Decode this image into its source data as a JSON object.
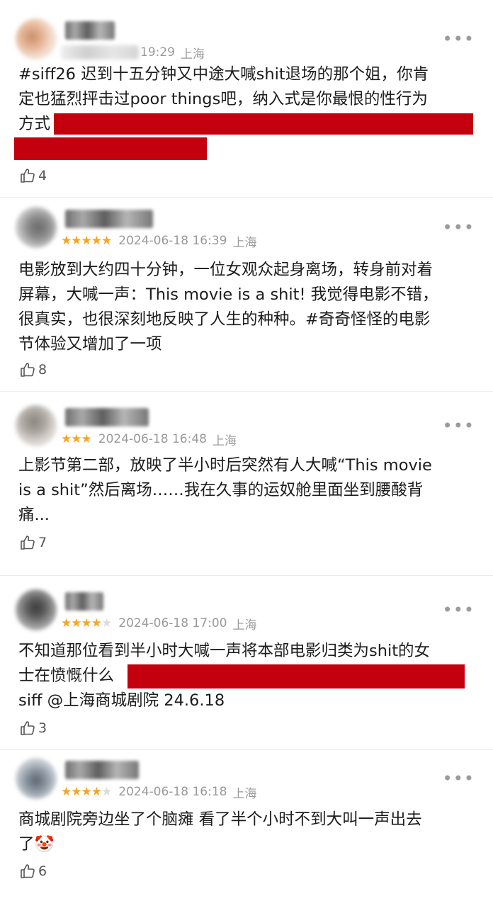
{
  "reviews": [
    {
      "user_blurred": true,
      "stars": null,
      "date": "",
      "time": "19:29",
      "location": "上海",
      "lines": [
        "#siff26 迟到十五分钟又中途大喊shit退场的那个姐，你肯",
        "定也猛烈抨击过poor things吧，纳入式是你最恨的性行为",
        "方式"
      ],
      "likes": "4"
    },
    {
      "user_blurred": true,
      "stars": 5,
      "date": "2024-06-18",
      "time": "16:39",
      "location": "上海",
      "lines": [
        "电影放到大约四十分钟，一位女观众起身离场，转身前对着",
        "屏幕，大喊一声：This movie is a shit! 我觉得电影不错，",
        "很真实，也很深刻地反映了人生的种种。#奇奇怪怪的电影",
        "节体验又增加了一项"
      ],
      "likes": "8"
    },
    {
      "user_blurred": true,
      "stars": 3,
      "date": "2024-06-18",
      "time": "16:48",
      "location": "上海",
      "lines": [
        "上影节第二部，放映了半小时后突然有人大喊“This movie",
        "is a shit”然后离场……我在久事的运奴舱里面坐到腰酸背",
        "痛..."
      ],
      "likes": "7"
    },
    {
      "user_blurred": true,
      "stars": 4,
      "date": "2024-06-18",
      "time": "17:00",
      "location": "上海",
      "lines": [
        "不知道那位看到半小时大喊一声将本部电影归类为shit的女",
        "士在愤慨什么",
        "siff @上海商城剧院 24.6.18"
      ],
      "likes": "3"
    },
    {
      "user_blurred": true,
      "stars": 4,
      "date": "2024-06-18",
      "time": "16:18",
      "location": "上海",
      "lines": [
        "商城剧院旁边坐了个脑瘫 看了半个小时不到大叫一声出去",
        "了🤡"
      ],
      "likes": "6"
    }
  ],
  "colors": {
    "star_on": "#f5a623",
    "star_off": "#dcdcdc",
    "redaction": "#c5000e",
    "meta_text": "#9a9a9a"
  },
  "icons": {
    "like": "thumbs-up-icon",
    "more": "more-dots-icon"
  }
}
